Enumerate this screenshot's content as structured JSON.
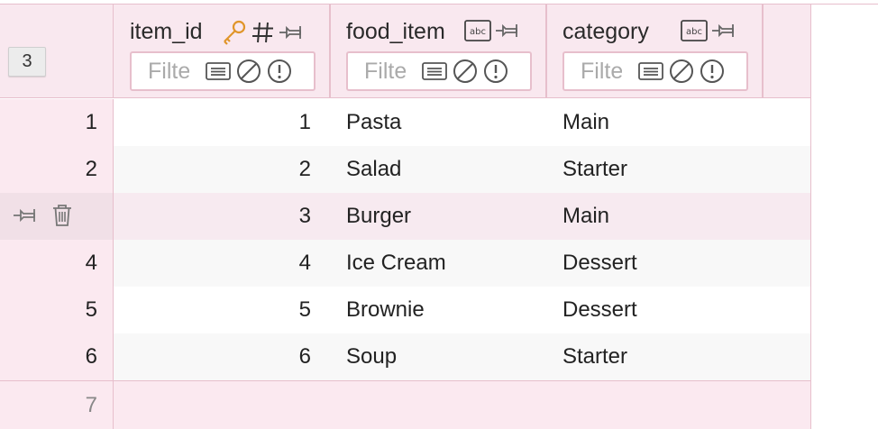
{
  "selection": {
    "count_label": "3"
  },
  "columns": [
    {
      "name": "item_id",
      "filter_placeholder": "Filter",
      "icons": [
        "key-icon",
        "number-icon",
        "pin-icon"
      ]
    },
    {
      "name": "food_item",
      "filter_placeholder": "Filter",
      "icons": [
        "text-type-icon",
        "pin-icon"
      ]
    },
    {
      "name": "category",
      "filter_placeholder": "Filter",
      "icons": [
        "text-type-icon",
        "pin-icon"
      ]
    }
  ],
  "type_badge_text": "abc",
  "rows": [
    {
      "num": "1",
      "item_id": "1",
      "food_item": "Pasta",
      "category": "Main"
    },
    {
      "num": "2",
      "item_id": "2",
      "food_item": "Salad",
      "category": "Starter"
    },
    {
      "num": "",
      "item_id": "3",
      "food_item": "Burger",
      "category": "Main"
    },
    {
      "num": "4",
      "item_id": "4",
      "food_item": "Ice Cream",
      "category": "Dessert"
    },
    {
      "num": "5",
      "item_id": "5",
      "food_item": "Brownie",
      "category": "Dessert"
    },
    {
      "num": "6",
      "item_id": "6",
      "food_item": "Soup",
      "category": "Starter"
    }
  ],
  "new_row": {
    "num": "7"
  },
  "colors": {
    "header_bg": "#f9e8ef",
    "border": "#e7bfcc",
    "key_icon": "#e0952a",
    "selected_row": "#f7eaf0"
  }
}
